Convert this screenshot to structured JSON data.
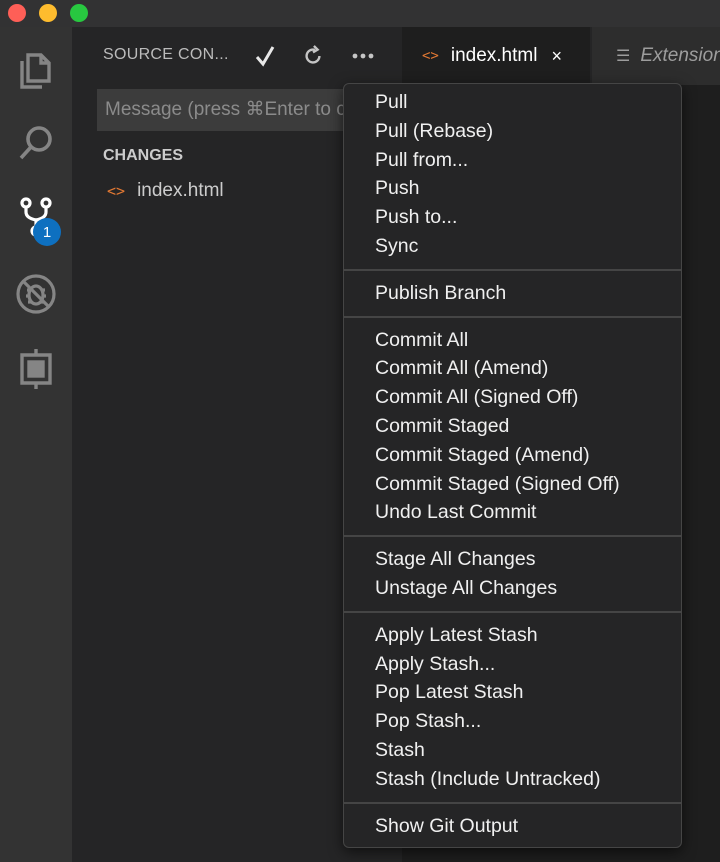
{
  "sidebar": {
    "title": "SOURCE CON...",
    "message_placeholder": "Message (press ⌘Enter to commit)",
    "changes_header": "CHANGES",
    "files": [
      {
        "name": "index.html",
        "icon": "html-file-icon"
      }
    ]
  },
  "activity": {
    "scm_badge": "1",
    "icons": [
      "explorer-icon",
      "search-icon",
      "source-control-icon",
      "debug-icon",
      "extensions-icon"
    ]
  },
  "tabs": [
    {
      "label": "index.html",
      "icon": "html-file-icon",
      "active": true,
      "close": "×"
    },
    {
      "label": "Extension",
      "icon": "readme-icon",
      "active": false
    }
  ],
  "menu": {
    "groups": [
      [
        "Pull",
        "Pull (Rebase)",
        "Pull from...",
        "Push",
        "Push to...",
        "Sync"
      ],
      [
        "Publish Branch"
      ],
      [
        "Commit All",
        "Commit All (Amend)",
        "Commit All (Signed Off)",
        "Commit Staged",
        "Commit Staged (Amend)",
        "Commit Staged (Signed Off)",
        "Undo Last Commit"
      ],
      [
        "Stage All Changes",
        "Unstage All Changes"
      ],
      [
        "Apply Latest Stash",
        "Apply Stash...",
        "Pop Latest Stash",
        "Pop Stash...",
        "Stash",
        "Stash (Include Untracked)"
      ],
      [
        "Show Git Output"
      ]
    ]
  },
  "colors": {
    "badge": "#0e70c0",
    "html_icon": "#e37933"
  }
}
